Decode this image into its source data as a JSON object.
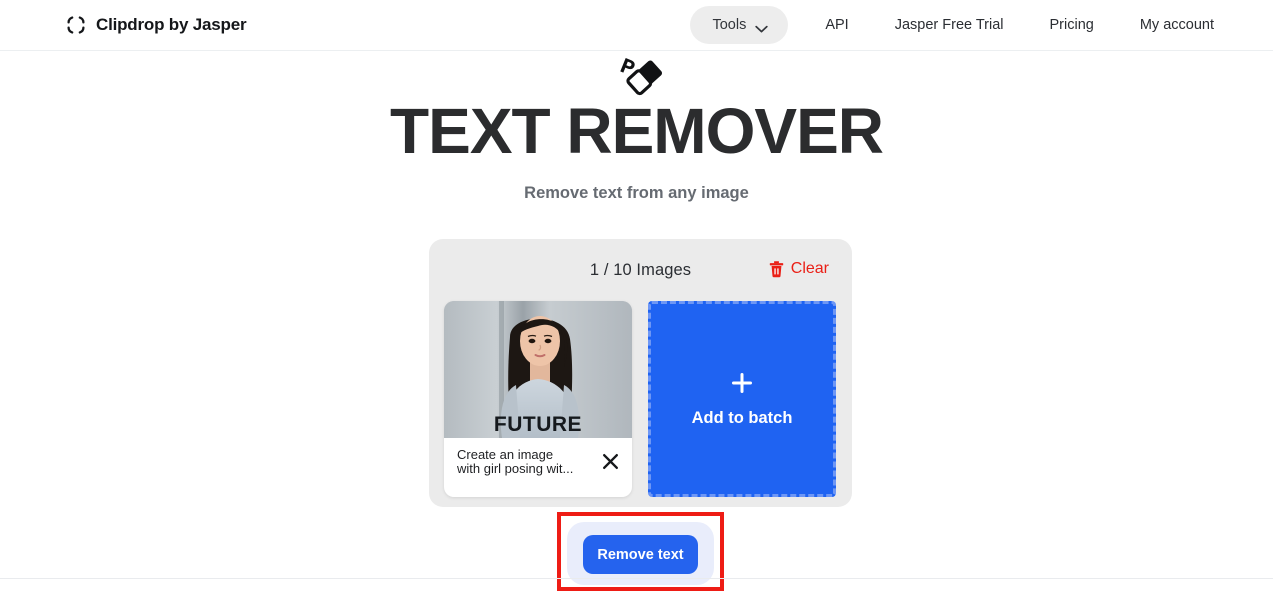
{
  "brand": {
    "logo_icon": "clipdrop-brackets-icon",
    "name": "Clipdrop by Jasper"
  },
  "nav": {
    "tools": {
      "label": "Tools",
      "icon": "chevron-down-icon"
    },
    "links": [
      {
        "label": "API"
      },
      {
        "label": "Jasper Free Trial"
      },
      {
        "label": "Pricing"
      },
      {
        "label": "My account"
      }
    ]
  },
  "hero": {
    "icon": "eraser-icon",
    "title": "TEXT REMOVER",
    "subtitle": "Remove text from any image"
  },
  "batch": {
    "count_label": "1 / 10 Images",
    "clear": {
      "label": "Clear",
      "icon": "trash-icon",
      "color": "#ea1f16"
    },
    "thumbnail": {
      "caption": "Create an image with girl posing wit...",
      "remove_icon": "close-x-icon",
      "image_alt": "girl in gray FUTURE t-shirt"
    },
    "add_tile": {
      "label": "Add to batch",
      "icon": "plus-icon",
      "color": "#1f63f2"
    }
  },
  "submit": {
    "label": "Remove text",
    "color": "#2563ee",
    "highlight_color": "#ee1c15"
  }
}
